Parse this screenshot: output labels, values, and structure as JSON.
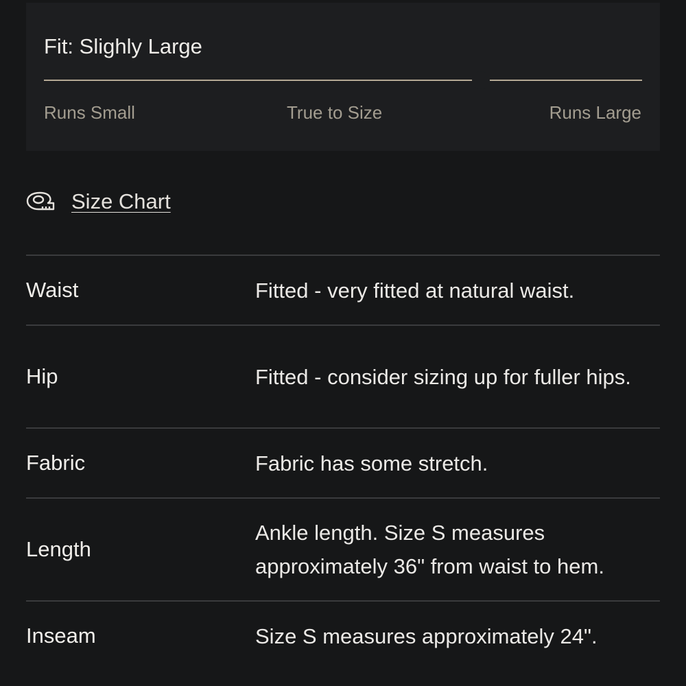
{
  "fit": {
    "title": "Fit: Slighly Large",
    "level": 0.73,
    "scale_labels": {
      "runs_small": "Runs Small",
      "true_to_size": "True to Size",
      "runs_large": "Runs Large"
    }
  },
  "size_chart": {
    "icon": "measuring-tape-icon",
    "label": "Size Chart"
  },
  "details": [
    {
      "label": "Waist",
      "value": "Fitted - very fitted at natural waist."
    },
    {
      "label": "Hip",
      "value": "Fitted - consider sizing up for fuller hips."
    },
    {
      "label": "Fabric",
      "value": "Fabric has some stretch."
    },
    {
      "label": "Length",
      "value": "Ankle length. Size S measures approximately 36\" from waist to hem."
    },
    {
      "label": "Inseam",
      "value": "Size S measures approximately 24\"."
    }
  ],
  "colors": {
    "background": "#161718",
    "card": "#1d1e20",
    "track": "#b5aa95",
    "divider": "#3a3b3d"
  }
}
